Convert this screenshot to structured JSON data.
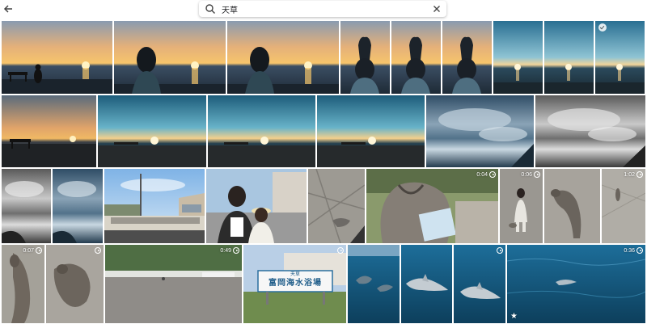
{
  "search": {
    "query": "天草",
    "icon": "search-icon",
    "clear_icon": "close-icon"
  },
  "nav": {
    "back_icon": "arrow-left-icon"
  },
  "photos": [
    {
      "id": "r1-sunset-person-bench"
    },
    {
      "id": "r1-silhouette-woman-1"
    },
    {
      "id": "r1-silhouette-woman-2"
    },
    {
      "id": "r1-hands-sun-1"
    },
    {
      "id": "r1-hands-sun-2"
    },
    {
      "id": "r1-hands-sun-3"
    },
    {
      "id": "r1-blue-sunset-1"
    },
    {
      "id": "r1-blue-sunset-2"
    },
    {
      "id": "r1-blue-sunset-3",
      "selected": true
    },
    {
      "id": "r2-orange-sunset"
    },
    {
      "id": "r2-teal-sunset-1"
    },
    {
      "id": "r2-teal-sunset-2"
    },
    {
      "id": "r2-teal-sunset-3"
    },
    {
      "id": "r2-clouds-sea"
    },
    {
      "id": "r2-clouds-sea-bw"
    },
    {
      "id": "r3-clouds-bw"
    },
    {
      "id": "r3-clouds-color"
    },
    {
      "id": "r3-school-street"
    },
    {
      "id": "r3-couple-selfie"
    },
    {
      "id": "r3-cat-ground"
    },
    {
      "id": "r3-cat-eating",
      "video": {
        "duration": "0:04"
      }
    },
    {
      "id": "r3-girl-cat",
      "video": {
        "duration": "0:06"
      }
    },
    {
      "id": "r3-cat-walking"
    },
    {
      "id": "r3-cat-far",
      "video": {
        "duration": "1:02"
      }
    },
    {
      "id": "r4-cat-close-1",
      "video": {
        "duration": "0:07"
      }
    },
    {
      "id": "r4-cat-close-2",
      "video": {
        "duration": ""
      }
    },
    {
      "id": "r4-parking",
      "video": {
        "duration": "0:49"
      }
    },
    {
      "id": "r4-beach-sign",
      "sign_line1": "天草",
      "sign_line2": "富岡海水浴場",
      "video": {
        "duration": ""
      }
    },
    {
      "id": "r4-dolphins-1"
    },
    {
      "id": "r4-dolphins-2"
    },
    {
      "id": "r4-dolphins-3",
      "video": {
        "duration": ""
      }
    },
    {
      "id": "r4-dolphin-sea",
      "video": {
        "duration": "0:36"
      },
      "favorite": true
    }
  ]
}
